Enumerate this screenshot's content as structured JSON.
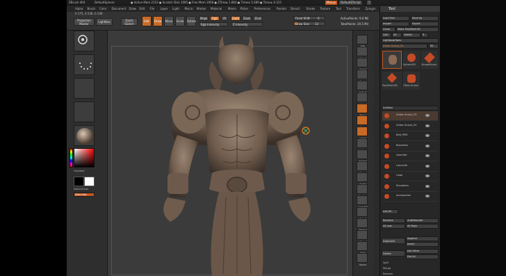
{
  "app": {
    "title_items": [
      "ZBrush 4R4",
      "DefaultSphere",
      "● Active Mem 2153 ● Scratch Disk 1095 ● Free Mem 1958 ● ZTime▸ 1.864 ● Timer▸ 5.089 ● Timer▸ 0.315"
    ],
    "menus_btn": "Menus",
    "script_btn": "DefaultZScript",
    "coords": "0.175, 4.538, 0.148"
  },
  "menu": [
    "Alpha",
    "Brush",
    "Color",
    "Document",
    "Draw",
    "Edit",
    "File",
    "Layer",
    "Light",
    "Macro",
    "Marker",
    "Material",
    "Movie",
    "Picker",
    "Preferences",
    "Render",
    "Stencil",
    "Stroke",
    "Texture",
    "Tool",
    "Transform",
    "Zplugin",
    "Zscript"
  ],
  "shelf": {
    "projection_master": "Projection Master",
    "lightbox": "LightBox",
    "quick_sketch": "Quick Sketch",
    "edit": "Edit",
    "draw": "Draw",
    "move": "Move",
    "scale": "Scale",
    "rotate": "Rotate",
    "mrgb": "Mrgb",
    "rgb": "Rgb",
    "m": "M",
    "zadd": "Zadd",
    "zsub": "Zsub",
    "zcut": "Zcut",
    "rgb_intensity": "Rgb Intensity",
    "z_intensity": "Z Intensity",
    "focal_shift_label": "Focal Shift",
    "focal_shift_value": "0",
    "draw_size_label": "Draw Size",
    "draw_size_value": "12",
    "active_points": "ActivePoints: 9.6 Mil",
    "total_points": "TotalPoints: 20.5 Mil"
  },
  "left": {
    "gradient": "Gradient",
    "switch_color": "SwitchColor",
    "alternate": "Alternate"
  },
  "right_shelf": [
    "BPR",
    "SPix 3",
    "Scroll",
    "Zoom",
    "Actual",
    "AAHalf",
    "Persp",
    "Floor",
    "Local",
    "L.Sym",
    "Frame",
    "Move",
    "Scale",
    "Rotate",
    "Line Fill",
    "PolyF",
    "Transp",
    "Ghost",
    "Solo",
    "Xpose"
  ],
  "tool": {
    "header": "Tool",
    "load_tool": "Load Tool",
    "save_as": "Save As",
    "import": "Import",
    "export": "Export",
    "clone": "Clone",
    "make_polymesh": "Make PolyMesh3D",
    "goz": "GoZ",
    "all": "All",
    "visible": "Visible",
    "r": "R",
    "lightbox_tools": "Lightbox▸Tools",
    "current_tool": "Zoltar-Sculpt_53",
    "count": "63",
    "thumbs": [
      "Zoltar-Sculpt_53",
      "Sphere3D",
      "SimpleBrush",
      "PolyMesh3D",
      "ZTool-Sculpt"
    ],
    "subtool_header": "SubTool",
    "subtools": [
      "Zoltar-Sculpt_53",
      "Zoltar-Sculpt_53",
      "Belt_PM3",
      "Bracelets",
      "Gauntlet",
      "Loincloth",
      "Cape",
      "Shoulders",
      "Accessories"
    ],
    "list_all": "List All",
    "rename": "Rename",
    "auto_reorder": "AutoReorder",
    "all_low": "All Low",
    "all_high": "All High",
    "duplicate": "Duplicate",
    "append": "Append",
    "insert": "Insert",
    "delete": "Delete",
    "del_other": "Del Other",
    "del_all": "Del All",
    "split": "Split",
    "merge": "Merge",
    "remesh": "Remesh"
  },
  "colors": {
    "accent": "#c86a26",
    "panel": "#272727",
    "canvas": "#3b3b3b",
    "figure": "#7a6656"
  }
}
